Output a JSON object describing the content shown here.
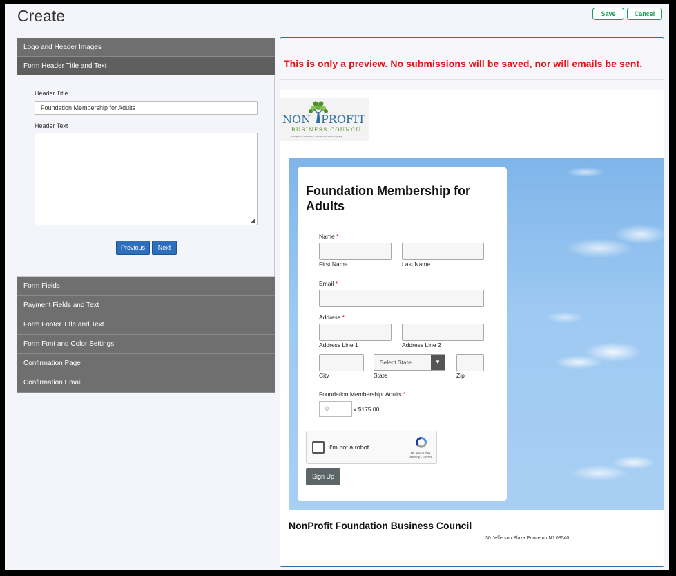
{
  "page": {
    "title": "Create"
  },
  "header_buttons": {
    "save": "Save",
    "cancel": "Cancel"
  },
  "accordion": {
    "top_items": [
      {
        "label": "Logo and Header Images"
      },
      {
        "label": "Form Header Title and Text"
      }
    ],
    "panel": {
      "header_title_label": "Header Title",
      "header_title_value": "Foundation Membership for Adults",
      "header_text_label": "Header Text",
      "header_text_value": "",
      "previous_label": "Previous",
      "next_label": "Next"
    },
    "bottom_items": [
      {
        "label": "Form Fields"
      },
      {
        "label": "Payment Fields and Text"
      },
      {
        "label": "Form Footer Title and Text"
      },
      {
        "label": "Form Font and Color Settings"
      },
      {
        "label": "Confirmation Page"
      },
      {
        "label": "Confirmation Email"
      }
    ]
  },
  "preview": {
    "notice": "This is only a preview. No submissions will be saved, nor will emails be sent.",
    "logo": {
      "line1_left": "NON",
      "line1_right": "PROFIT",
      "line2": "BUSINESS COUNCIL",
      "tagline": "A Program of COMMUNITY FOUNDATION Southern Jersey"
    },
    "form": {
      "title": "Foundation Membership for Adults",
      "name_label": "Name",
      "first_name": "First Name",
      "last_name": "Last Name",
      "email_label": "Email",
      "address_label": "Address",
      "address_line1": "Address Line 1",
      "address_line2": "Address Line 2",
      "state_placeholder": "Select State",
      "city": "City",
      "state": "State",
      "zip": "Zip",
      "membership_label": "Foundation Membership: Adults",
      "quantity_placeholder": "0",
      "price": "x $175.00",
      "captcha_text": "I'm not a robot",
      "captcha_brand": "reCAPTCHA",
      "captcha_links": "Privacy - Terms",
      "submit": "Sign Up",
      "required_mark": "*"
    },
    "footer": {
      "title": "NonProfit Foundation Business Council",
      "address": "30 Jefferson Plaza Princeton NJ 08540"
    }
  },
  "colors": {
    "accent_green": "#1a9b5b",
    "nav_blue": "#2e6fbd",
    "notice_red": "#e41414",
    "accordion_gray": "#6f6f6f"
  }
}
